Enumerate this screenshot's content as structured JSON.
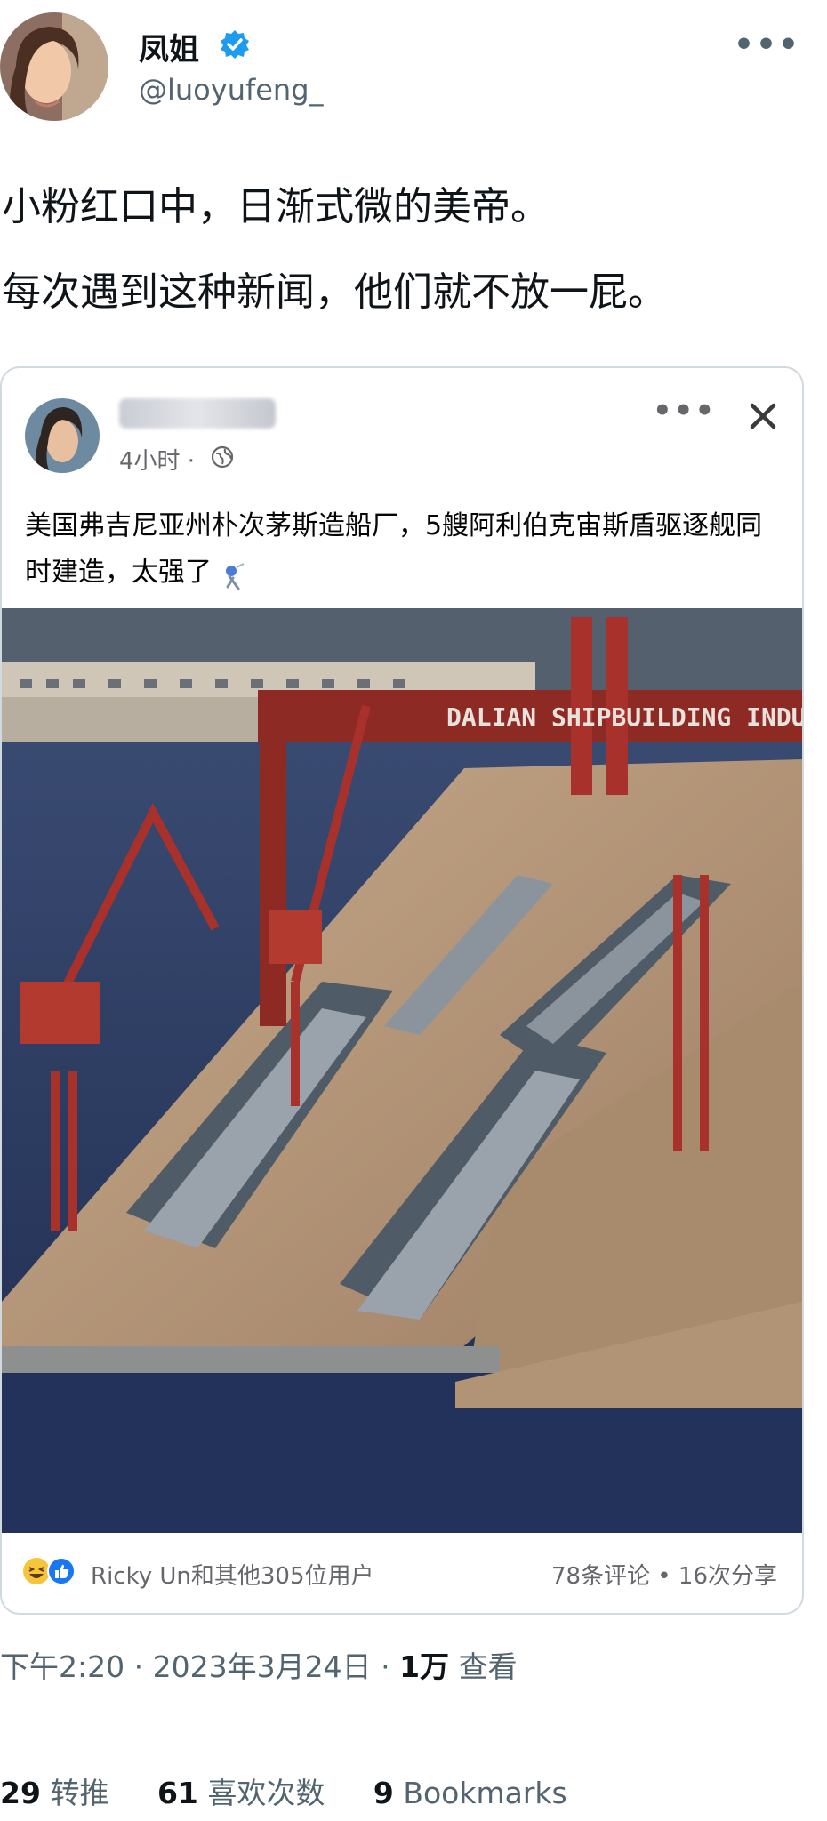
{
  "author": {
    "name": "凤姐",
    "handle": "@luoyufeng_",
    "verified_color": "#1d9bf0"
  },
  "post": {
    "lines": [
      "小粉红口中，日渐式微的美帝。",
      "每次遇到这种新闻，他们就不放一屁。"
    ]
  },
  "embedded_post": {
    "time": "4小时 ·",
    "text": "美国弗吉尼亚州朴次茅斯造船厂，5艘阿利伯克宙斯盾驱逐舰同时建造，太强了",
    "image_sign": "DALIAN SHIPBUILDING INDUSTRY",
    "reactions_text": "Ricky Un和其他305位用户",
    "stats": "78条评论 • 16次分享",
    "icons": [
      "globe-icon",
      "close-icon",
      "more-icon",
      "haha-reaction-icon",
      "like-reaction-icon"
    ]
  },
  "meta": {
    "time": "下午2:20",
    "sep": "·",
    "date": "2023年3月24日",
    "views_count": "1万",
    "views_label": "查看"
  },
  "stats": {
    "retweets_count": "29",
    "retweets_label": "转推",
    "likes_count": "61",
    "likes_label": "喜欢次数",
    "bookmarks_count": "9",
    "bookmarks_label": "Bookmarks"
  },
  "colors": {
    "text": "#0f1419",
    "secondary": "#536471",
    "fb_secondary": "#65676b",
    "card_border": "#cfd9de"
  }
}
